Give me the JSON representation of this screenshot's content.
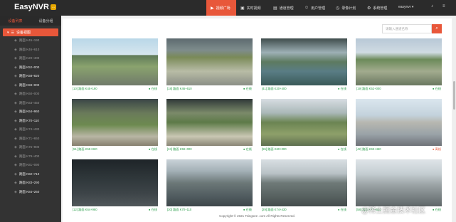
{
  "app": {
    "title": "EasyNVR",
    "badge": "..."
  },
  "nav": [
    {
      "label": "视频广场",
      "icon": "▶",
      "active": true
    },
    {
      "label": "实时视频",
      "icon": "▣"
    },
    {
      "label": "通道管理",
      "icon": "▤"
    },
    {
      "label": "用户管理",
      "icon": "☺"
    },
    {
      "label": "录像计划",
      "icon": "◷"
    },
    {
      "label": "系统管理",
      "icon": "⚙"
    }
  ],
  "user": "easynvr ▾",
  "sidebar": {
    "tabs": [
      "设备列表",
      "设备分组"
    ],
    "group": "设备视图",
    "cameras": [
      {
        "name": "路面 K45+190",
        "on": false
      },
      {
        "name": "路面 K46+610",
        "on": false
      },
      {
        "name": "路面 K20+400",
        "on": false
      },
      {
        "name": "路面 K52+000",
        "on": true
      },
      {
        "name": "路面 K58+820",
        "on": true
      },
      {
        "name": "路面 K59+000",
        "on": true
      },
      {
        "name": "路面 K60+000",
        "on": false
      },
      {
        "name": "路面 K63+450",
        "on": false
      },
      {
        "name": "路面 K64+960",
        "on": true
      },
      {
        "name": "路面 K70+110",
        "on": true
      },
      {
        "name": "路面 K74+430",
        "on": false
      },
      {
        "name": "路面 K71+650",
        "on": false
      },
      {
        "name": "路面 K76+900",
        "on": false
      },
      {
        "name": "路面 K79+400",
        "on": false
      },
      {
        "name": "路面 K81+090",
        "on": false
      },
      {
        "name": "路面 K82+710",
        "on": true
      },
      {
        "name": "路面 K83+290",
        "on": true
      },
      {
        "name": "路面 K84+250",
        "on": true
      }
    ]
  },
  "search": {
    "placeholder": "请输入通道名称"
  },
  "tiles": [
    {
      "caption": "[10] 路面 K45+190",
      "status": "● 在线"
    },
    {
      "caption": "[18] 路面 K46+610",
      "status": "● 在线"
    },
    {
      "caption": "[41] 路面 K20+400",
      "status": "● 在线"
    },
    {
      "caption": "[19] 路面 K52+000",
      "status": "● 在线"
    },
    {
      "caption": "[51] 路面 K58+820",
      "status": "● 在线"
    },
    {
      "caption": "[24] 路面 K59+000",
      "status": "● 在线"
    },
    {
      "caption": "[55] 路面 K60+000",
      "status": "● 在线"
    },
    {
      "caption": "[42] 路面 K63+450",
      "status": "● 离线"
    },
    {
      "caption": "[12] 路面 K64+960",
      "status": "● 在线"
    },
    {
      "caption": "[30] 路面 K70+110",
      "status": "● 在线"
    },
    {
      "caption": "[29] 路面 K74+430",
      "status": "● 在线"
    },
    {
      "caption": "[58] 路面 K71+650",
      "status": "● 在线"
    }
  ],
  "footer": "Copyright © 2021 Tsingsee .com All Rights Reserved.",
  "watermark": "@稀土掘金技术社区"
}
